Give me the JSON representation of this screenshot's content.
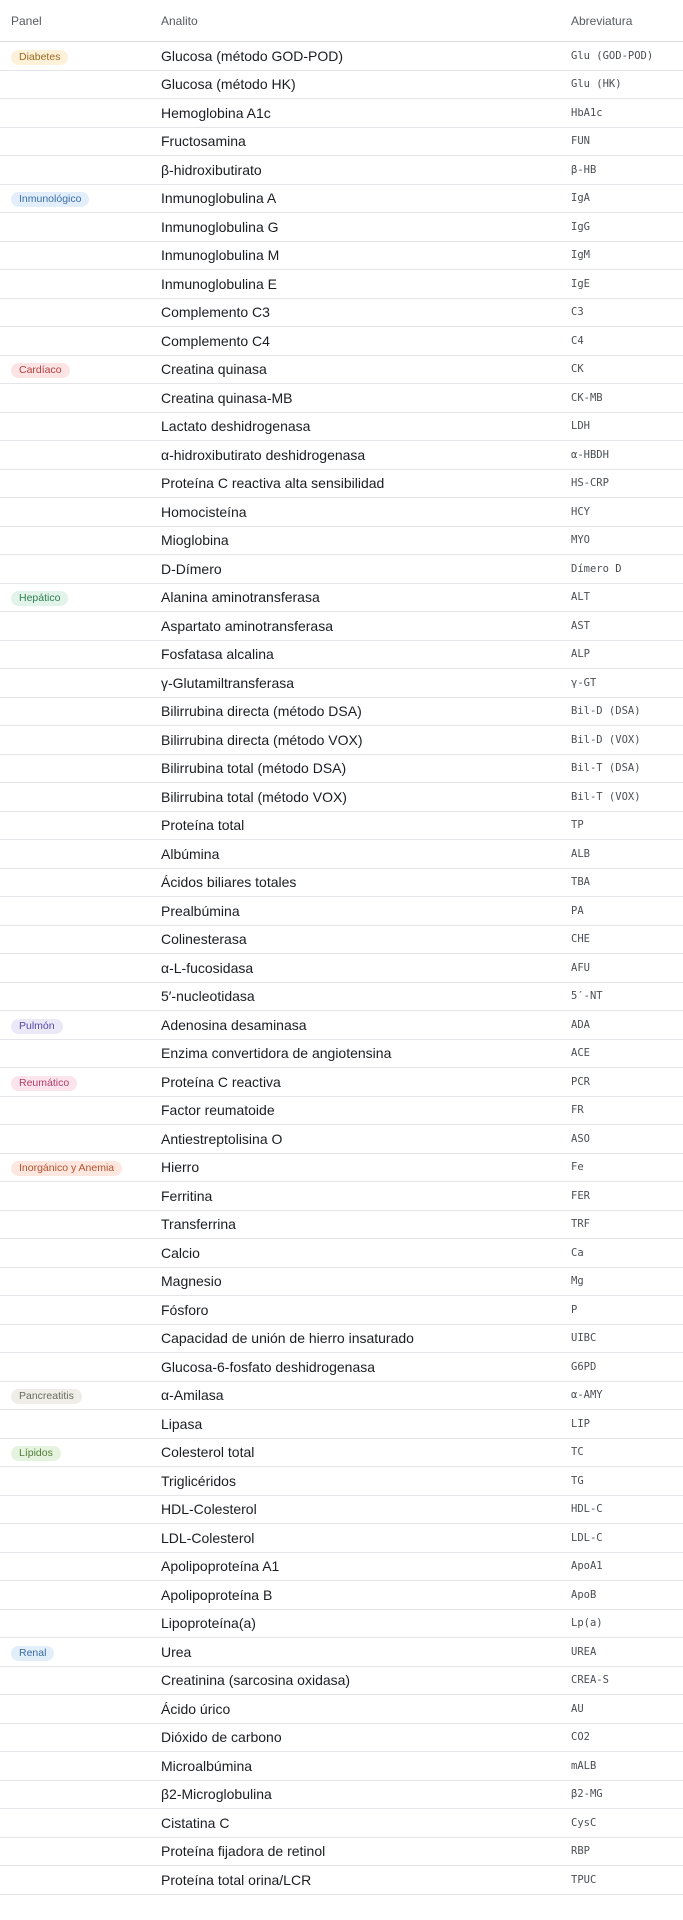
{
  "headers": {
    "panel": "Panel",
    "analyte": "Analito",
    "abbreviation": "Abreviatura"
  },
  "panel_colors": {
    "Diabetes": {
      "bg": "#fdf1da",
      "fg": "#9a6a1f"
    },
    "Inmunológico": {
      "bg": "#e3eefb",
      "fg": "#3b6ea8"
    },
    "Cardíaco": {
      "bg": "#fde4e4",
      "fg": "#b3403e"
    },
    "Hepático": {
      "bg": "#e2f4ea",
      "fg": "#2f7d50"
    },
    "Pulmón": {
      "bg": "#ebe8f8",
      "fg": "#5548a3"
    },
    "Reumático": {
      "bg": "#fbe4ec",
      "fg": "#b03d67"
    },
    "Inorgánico y Anemia": {
      "bg": "#fde7df",
      "fg": "#b2512d"
    },
    "Pancreatitis": {
      "bg": "#eeede8",
      "fg": "#6d6a5f"
    },
    "Lípidos": {
      "bg": "#e6f4df",
      "fg": "#4f7d36"
    },
    "Renal": {
      "bg": "#e2eefa",
      "fg": "#3a6b9f"
    }
  },
  "rows": [
    {
      "panel": "Diabetes",
      "analyte": "Glucosa (método GOD-POD)",
      "abbr": "Glu (GOD-POD)"
    },
    {
      "panel": "",
      "analyte": "Glucosa (método HK)",
      "abbr": "Glu (HK)"
    },
    {
      "panel": "",
      "analyte": "Hemoglobina A1c",
      "abbr": "HbA1c"
    },
    {
      "panel": "",
      "analyte": "Fructosamina",
      "abbr": "FUN"
    },
    {
      "panel": "",
      "analyte": "β-hidroxibutirato",
      "abbr": "β-HB"
    },
    {
      "panel": "Inmunológico",
      "analyte": "Inmunoglobulina A",
      "abbr": "IgA"
    },
    {
      "panel": "",
      "analyte": "Inmunoglobulina G",
      "abbr": "IgG"
    },
    {
      "panel": "",
      "analyte": "Inmunoglobulina M",
      "abbr": "IgM"
    },
    {
      "panel": "",
      "analyte": "Inmunoglobulina E",
      "abbr": "IgE"
    },
    {
      "panel": "",
      "analyte": "Complemento C3",
      "abbr": "C3"
    },
    {
      "panel": "",
      "analyte": "Complemento C4",
      "abbr": "C4"
    },
    {
      "panel": "Cardíaco",
      "analyte": "Creatina quinasa",
      "abbr": "CK"
    },
    {
      "panel": "",
      "analyte": "Creatina quinasa-MB",
      "abbr": "CK-MB"
    },
    {
      "panel": "",
      "analyte": "Lactato deshidrogenasa",
      "abbr": "LDH"
    },
    {
      "panel": "",
      "analyte": "α-hidroxibutirato deshidrogenasa",
      "abbr": "α-HBDH"
    },
    {
      "panel": "",
      "analyte": "Proteína C reactiva alta sensibilidad",
      "abbr": "HS-CRP"
    },
    {
      "panel": "",
      "analyte": "Homocisteína",
      "abbr": "HCY"
    },
    {
      "panel": "",
      "analyte": "Mioglobina",
      "abbr": "MYO"
    },
    {
      "panel": "",
      "analyte": "D-Dímero",
      "abbr": "Dímero D"
    },
    {
      "panel": "Hepático",
      "analyte": "Alanina aminotransferasa",
      "abbr": "ALT"
    },
    {
      "panel": "",
      "analyte": "Aspartato aminotransferasa",
      "abbr": "AST"
    },
    {
      "panel": "",
      "analyte": "Fosfatasa alcalina",
      "abbr": "ALP"
    },
    {
      "panel": "",
      "analyte": "γ-Glutamiltransferasa",
      "abbr": "γ-GT"
    },
    {
      "panel": "",
      "analyte": "Bilirrubina directa (método DSA)",
      "abbr": "Bil-D (DSA)"
    },
    {
      "panel": "",
      "analyte": "Bilirrubina directa (método VOX)",
      "abbr": "Bil-D (VOX)"
    },
    {
      "panel": "",
      "analyte": "Bilirrubina total (método DSA)",
      "abbr": "Bil-T (DSA)"
    },
    {
      "panel": "",
      "analyte": "Bilirrubina total (método VOX)",
      "abbr": "Bil-T (VOX)"
    },
    {
      "panel": "",
      "analyte": "Proteína total",
      "abbr": "TP"
    },
    {
      "panel": "",
      "analyte": "Albúmina",
      "abbr": "ALB"
    },
    {
      "panel": "",
      "analyte": "Ácidos biliares totales",
      "abbr": "TBA"
    },
    {
      "panel": "",
      "analyte": "Prealbúmina",
      "abbr": "PA"
    },
    {
      "panel": "",
      "analyte": "Colinesterasa",
      "abbr": "CHE"
    },
    {
      "panel": "",
      "analyte": "α-L-fucosidasa",
      "abbr": "AFU"
    },
    {
      "panel": "",
      "analyte": "5′-nucleotidasa",
      "abbr": "5′-NT"
    },
    {
      "panel": "Pulmón",
      "analyte": "Adenosina desaminasa",
      "abbr": "ADA"
    },
    {
      "panel": "",
      "analyte": "Enzima convertidora de angiotensina",
      "abbr": "ACE"
    },
    {
      "panel": "Reumático",
      "analyte": "Proteína C reactiva",
      "abbr": "PCR"
    },
    {
      "panel": "",
      "analyte": "Factor reumatoide",
      "abbr": "FR"
    },
    {
      "panel": "",
      "analyte": "Antiestreptolisina O",
      "abbr": "ASO"
    },
    {
      "panel": "Inorgánico y Anemia",
      "analyte": "Hierro",
      "abbr": "Fe"
    },
    {
      "panel": "",
      "analyte": "Ferritina",
      "abbr": "FER"
    },
    {
      "panel": "",
      "analyte": "Transferrina",
      "abbr": "TRF"
    },
    {
      "panel": "",
      "analyte": "Calcio",
      "abbr": "Ca"
    },
    {
      "panel": "",
      "analyte": "Magnesio",
      "abbr": "Mg"
    },
    {
      "panel": "",
      "analyte": "Fósforo",
      "abbr": "P"
    },
    {
      "panel": "",
      "analyte": "Capacidad de unión de hierro insaturado",
      "abbr": "UIBC"
    },
    {
      "panel": "",
      "analyte": "Glucosa-6-fosfato deshidrogenasa",
      "abbr": "G6PD"
    },
    {
      "panel": "Pancreatitis",
      "analyte": "α-Amilasa",
      "abbr": "α-AMY"
    },
    {
      "panel": "",
      "analyte": "Lipasa",
      "abbr": "LIP"
    },
    {
      "panel": "Lípidos",
      "analyte": "Colesterol total",
      "abbr": "TC"
    },
    {
      "panel": "",
      "analyte": "Triglicéridos",
      "abbr": "TG"
    },
    {
      "panel": "",
      "analyte": "HDL-Colesterol",
      "abbr": "HDL-C"
    },
    {
      "panel": "",
      "analyte": "LDL-Colesterol",
      "abbr": "LDL-C"
    },
    {
      "panel": "",
      "analyte": "Apolipoproteína A1",
      "abbr": "ApoA1"
    },
    {
      "panel": "",
      "analyte": "Apolipoproteína B",
      "abbr": "ApoB"
    },
    {
      "panel": "",
      "analyte": "Lipoproteína(a)",
      "abbr": "Lp(a)"
    },
    {
      "panel": "Renal",
      "analyte": "Urea",
      "abbr": "UREA"
    },
    {
      "panel": "",
      "analyte": "Creatinina (sarcosina oxidasa)",
      "abbr": "CREA-S"
    },
    {
      "panel": "",
      "analyte": "Ácido úrico",
      "abbr": "AU"
    },
    {
      "panel": "",
      "analyte": "Dióxido de carbono",
      "abbr": "CO2"
    },
    {
      "panel": "",
      "analyte": "Microalbúmina",
      "abbr": "mALB"
    },
    {
      "panel": "",
      "analyte": "β2-Microglobulina",
      "abbr": "β2-MG"
    },
    {
      "panel": "",
      "analyte": "Cistatina C",
      "abbr": "CysC"
    },
    {
      "panel": "",
      "analyte": "Proteína fijadora de retinol",
      "abbr": "RBP"
    },
    {
      "panel": "",
      "analyte": "Proteína total orina/LCR",
      "abbr": "TPUC"
    }
  ]
}
